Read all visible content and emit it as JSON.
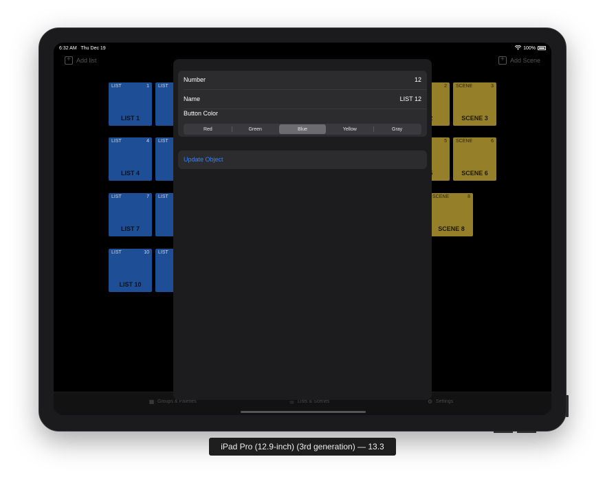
{
  "status_bar": {
    "time": "6:32 AM",
    "date": "Thu Dec 19",
    "battery": "100%"
  },
  "nav": {
    "add_list": "Add list",
    "add_scene": "Add Scene"
  },
  "lists": [
    {
      "label": "LIST",
      "number": "1",
      "name": "LIST 1"
    },
    {
      "label": "LIST",
      "number": "",
      "name": "LI"
    },
    {
      "label": "LIST",
      "number": "4",
      "name": "LIST 4"
    },
    {
      "label": "LIST",
      "number": "",
      "name": "LI"
    },
    {
      "label": "LIST",
      "number": "7",
      "name": "LIST 7"
    },
    {
      "label": "LIST",
      "number": "",
      "name": "LI"
    },
    {
      "label": "LIST",
      "number": "10",
      "name": "LIST 10"
    },
    {
      "label": "LIST",
      "number": "",
      "name": "LI"
    }
  ],
  "scenes": [
    {
      "label": "",
      "number": "2",
      "name": "E 2"
    },
    {
      "label": "SCENE",
      "number": "3",
      "name": "SCENE 3"
    },
    {
      "label": "",
      "number": "5",
      "name": "E 5"
    },
    {
      "label": "SCENE",
      "number": "6",
      "name": "SCENE 6"
    },
    {
      "label": "SCENE",
      "number": "8",
      "name": "SCENE 8"
    }
  ],
  "modal": {
    "number_label": "Number",
    "number_value": "12",
    "name_label": "Name",
    "name_value": "LIST 12",
    "button_color_label": "Button Color",
    "color_options": [
      "Red",
      "Green",
      "Blue",
      "Yellow",
      "Gray"
    ],
    "selected_color": "Blue",
    "update_button": "Update Object"
  },
  "tabs": [
    {
      "label": "Groups & Palettes",
      "icon": "grid-icon"
    },
    {
      "label": "Lists & Scenes",
      "icon": "list-icon"
    },
    {
      "label": "Settings",
      "icon": "gear-icon"
    }
  ],
  "caption": "iPad Pro (12.9-inch) (3rd generation) — 13.3",
  "colors": {
    "list_tile": "#1e4f96",
    "scene_tile": "#958029",
    "accent": "#3b82f6"
  }
}
